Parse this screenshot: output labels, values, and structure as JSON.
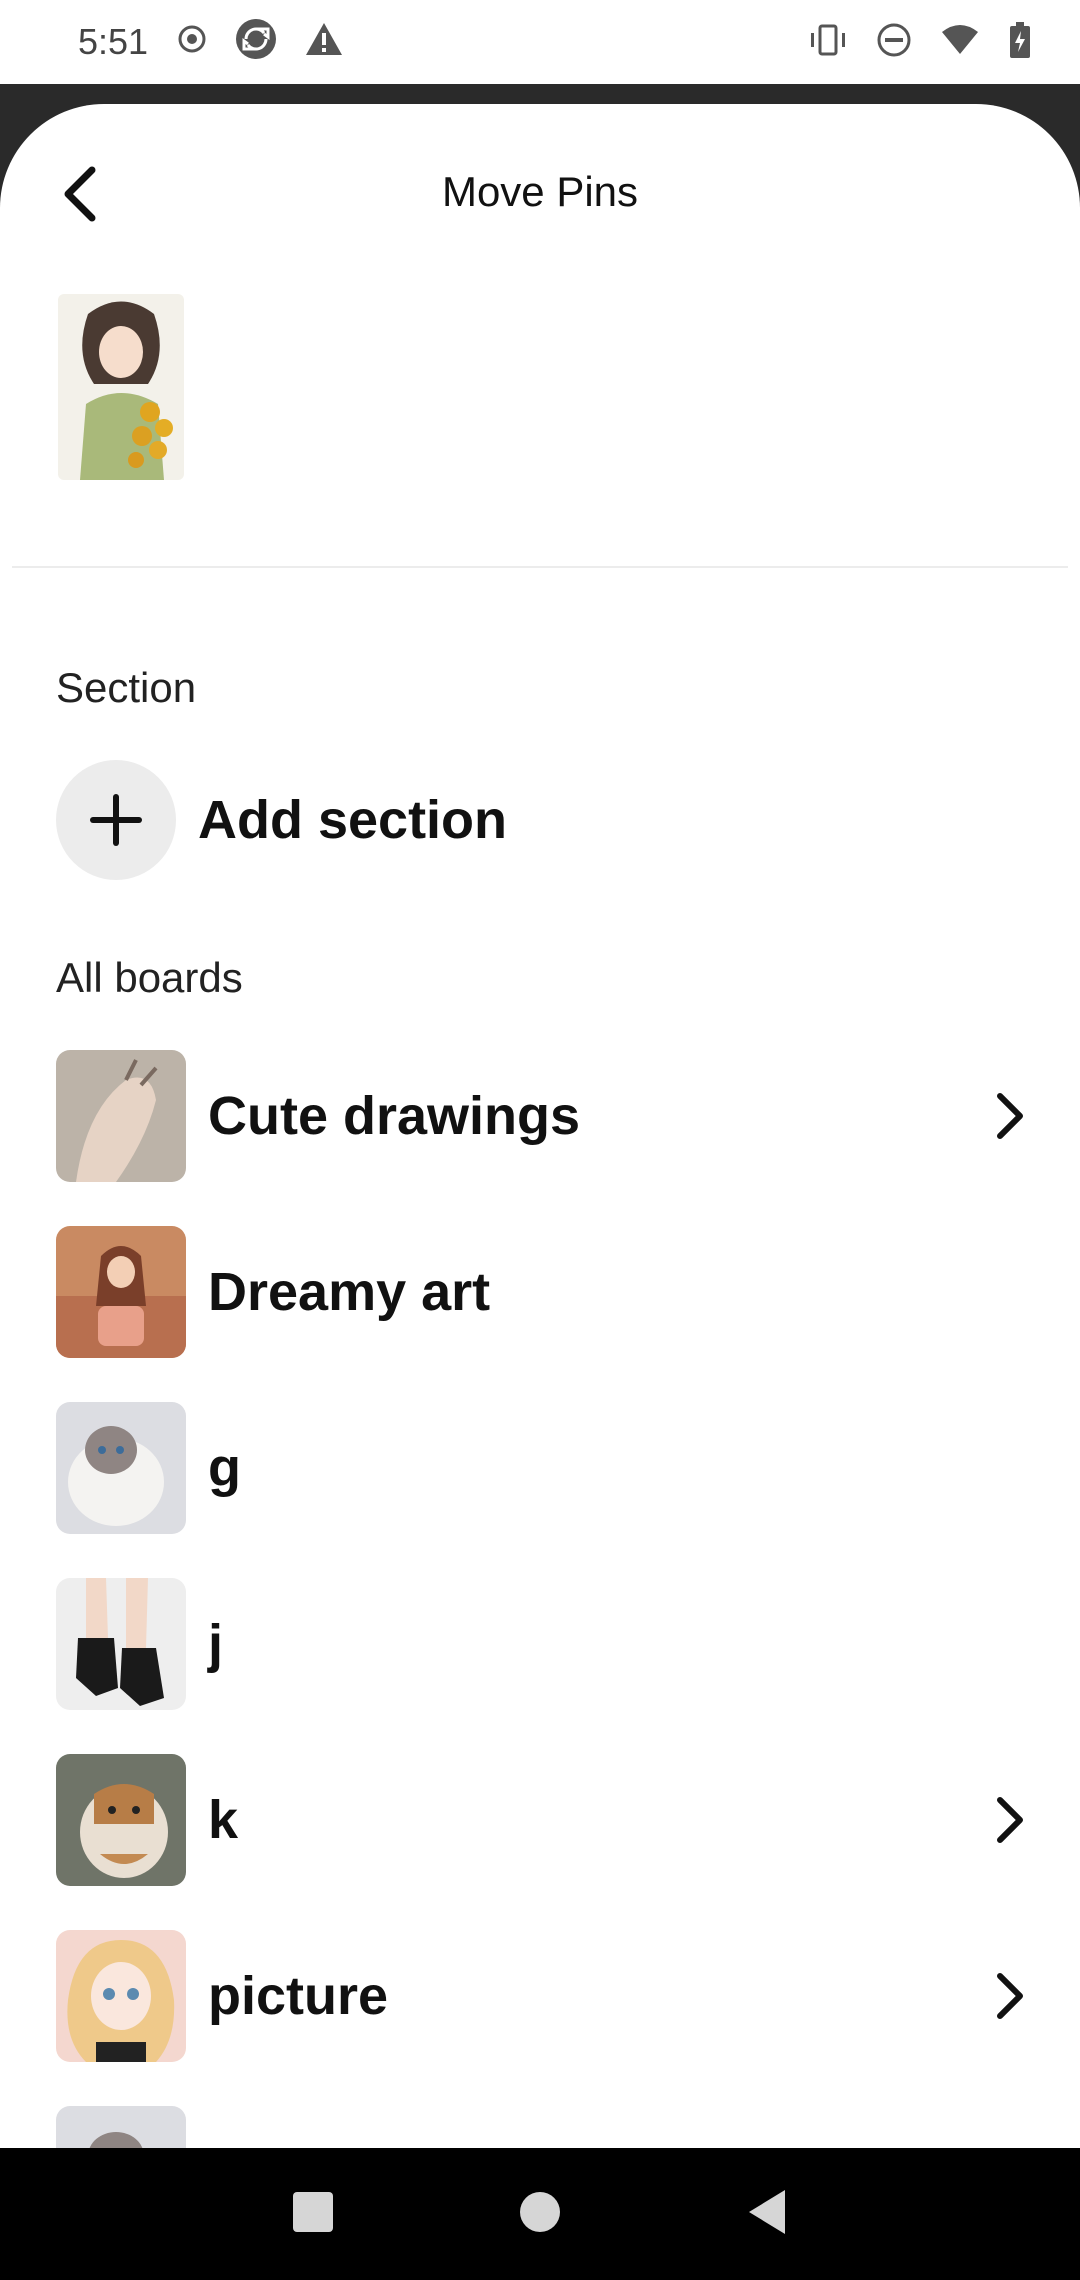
{
  "status_bar": {
    "time": "5:51",
    "left_icons": [
      "record-icon",
      "sync-icon",
      "warning-icon"
    ],
    "right_icons": [
      "vibrate-icon",
      "do-not-disturb-icon",
      "wifi-icon",
      "battery-charging-icon"
    ]
  },
  "header": {
    "title": "Move Pins",
    "back_icon": "chevron-left-icon"
  },
  "pin_preview": {
    "description": "girl-with-sunflowers-illustration"
  },
  "section": {
    "label": "Section",
    "add_label": "Add section",
    "add_icon": "plus-icon"
  },
  "boards": {
    "label": "All boards",
    "items": [
      {
        "name": "Cute drawings",
        "has_chevron": true
      },
      {
        "name": "Dreamy art",
        "has_chevron": false
      },
      {
        "name": "g",
        "has_chevron": false
      },
      {
        "name": "j",
        "has_chevron": false
      },
      {
        "name": "k",
        "has_chevron": true
      },
      {
        "name": "picture",
        "has_chevron": true
      }
    ]
  },
  "nav": {
    "icons": [
      "recents-square-icon",
      "home-circle-icon",
      "back-triangle-icon"
    ]
  },
  "colors": {
    "background": "#ffffff",
    "text": "#111111",
    "add_circle": "#ececec",
    "nav_bar": "#000000"
  }
}
